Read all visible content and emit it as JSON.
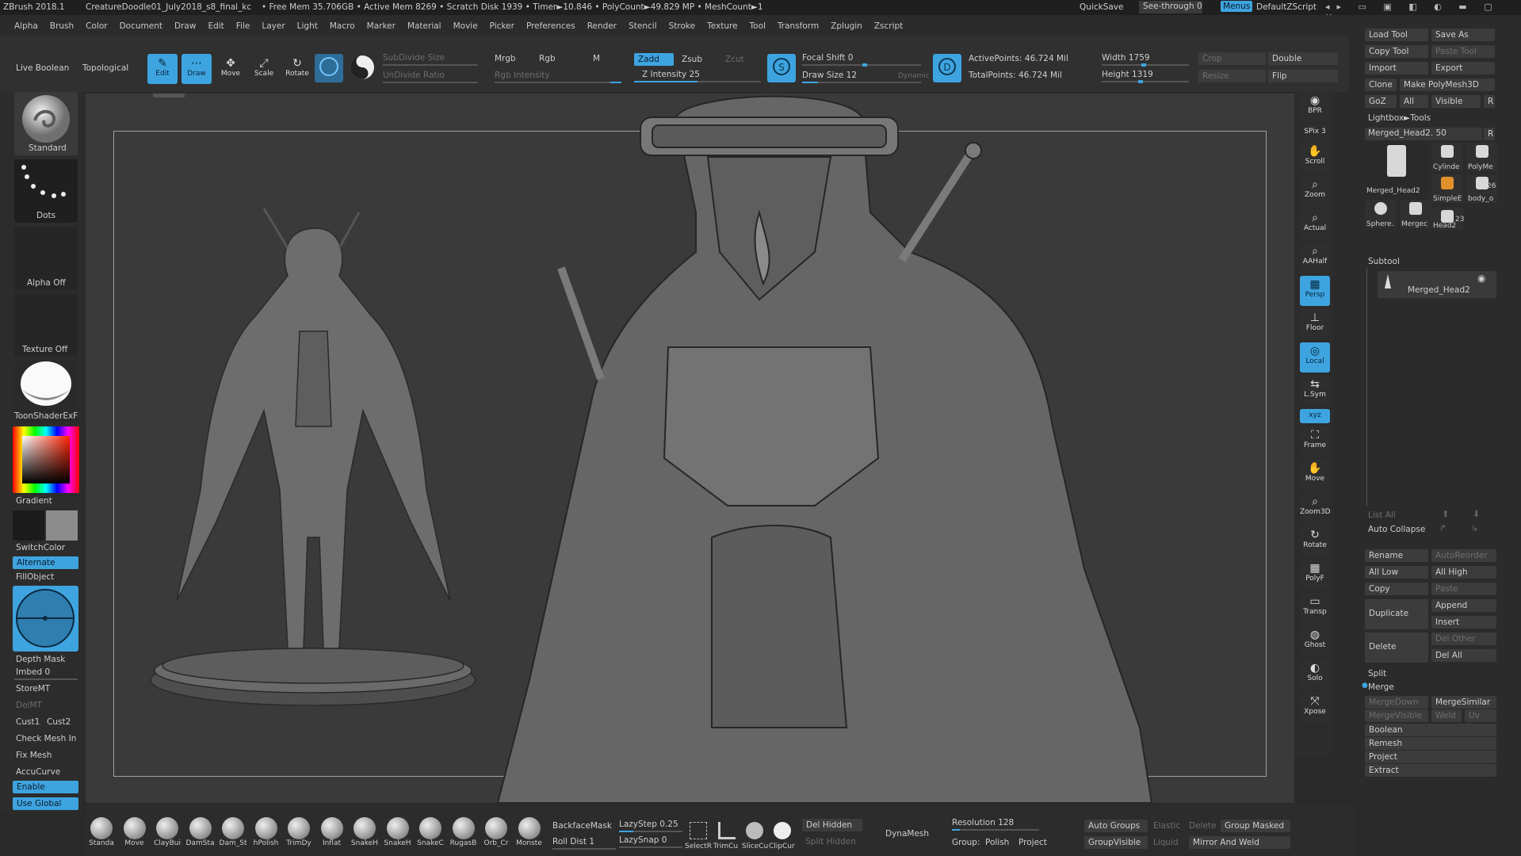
{
  "titlebar": {
    "title": "ZBrush 2018.1",
    "doc": "CreatureDoodle01_July2018_s8_final_kc",
    "stats": "• Free Mem 35.706GB • Active Mem 8269 • Scratch Disk 1939 • Timer►10.846 • PolyCount►49.829 MP • MeshCount►1",
    "quicksave": "QuickSave",
    "seethrough": "See-through  0",
    "menus": "Menus",
    "script": "DefaultZScript"
  },
  "menubar": [
    "Alpha",
    "Brush",
    "Color",
    "Document",
    "Draw",
    "Edit",
    "File",
    "Layer",
    "Light",
    "Macro",
    "Marker",
    "Material",
    "Movie",
    "Picker",
    "Preferences",
    "Render",
    "Stencil",
    "Stroke",
    "Texture",
    "Tool",
    "Transform",
    "Zplugin",
    "Zscript"
  ],
  "toolbar": {
    "live_boolean": "Live Boolean",
    "topological": "Topological",
    "modes": [
      {
        "label": "Edit",
        "on": true
      },
      {
        "label": "Draw",
        "on": true
      },
      {
        "label": "Move",
        "on": false
      },
      {
        "label": "Scale",
        "on": false
      },
      {
        "label": "Rotate",
        "on": false
      }
    ],
    "subdivide_size": "SubDivide Size",
    "undivide_ratio": "UnDivide Ratio",
    "mrgb": "Mrgb",
    "rgb": "Rgb",
    "m": "M",
    "rgb_intensity": "Rgb Intensity",
    "zadd": "Zadd",
    "zsub": "Zsub",
    "zcut": "Zcut",
    "z_intensity": "Z Intensity 25",
    "z_intensity_value": 25,
    "focal_shift": "Focal Shift 0",
    "draw_size": "Draw Size 12",
    "dynamic": "Dynamic",
    "active_points": "ActivePoints: 46.724 Mil",
    "total_points": "TotalPoints: 46.724 Mil",
    "width": "Width 1759",
    "height": "Height 1319",
    "crop": "Crop",
    "resize": "Resize",
    "double": "Double",
    "flip": "Flip"
  },
  "left_shelf": {
    "brush": "Standard",
    "stroke": "Dots",
    "alpha": "Alpha Off",
    "texture": "Texture Off",
    "material": "ToonShaderExF",
    "gradient": "Gradient",
    "switch_color": "SwitchColor",
    "alternate": "Alternate",
    "fill_object": "FillObject",
    "depth_mask": "Depth Mask",
    "imbed": "Imbed 0",
    "store_mt": "StoreMT",
    "del_mt": "DelMT",
    "cust1": "Cust1",
    "cust2": "Cust2",
    "check_mesh": "Check Mesh In",
    "fix_mesh": "Fix Mesh",
    "accucurve": "AccuCurve",
    "enable": "Enable",
    "use_global": "Use Global"
  },
  "right_shelf": [
    {
      "label": "BPR"
    },
    {
      "label": "SPix 3"
    },
    {
      "label": "Scroll"
    },
    {
      "label": "Zoom"
    },
    {
      "label": "Actual"
    },
    {
      "label": "AAHalf"
    },
    {
      "label": "Persp",
      "on": true
    },
    {
      "label": "Floor"
    },
    {
      "label": "Local",
      "on": true
    },
    {
      "label": "L.Sym"
    },
    {
      "label": "xyz",
      "on": true
    },
    {
      "label": "Frame"
    },
    {
      "label": "Move"
    },
    {
      "label": "Zoom3D"
    },
    {
      "label": "Rotate"
    },
    {
      "label": "PolyF"
    },
    {
      "label": "Transp"
    },
    {
      "label": "Ghost"
    },
    {
      "label": "Solo"
    },
    {
      "label": "Xpose"
    }
  ],
  "tool_panel": {
    "load_tool": "Load Tool",
    "save_as": "Save As",
    "copy_tool": "Copy Tool",
    "paste_tool": "Paste Tool",
    "import": "Import",
    "export": "Export",
    "clone": "Clone",
    "make_polymesh": "Make PolyMesh3D",
    "goz": "GoZ",
    "all": "All",
    "visible": "Visible",
    "r": "R",
    "lightbox": "Lightbox►Tools",
    "current_tool": "Merged_Head2. 50",
    "thumbs": [
      {
        "label": "Merged_Head2"
      },
      {
        "label": "Cylinde"
      },
      {
        "label": "PolyMe"
      },
      {
        "label": "SimpleE"
      },
      {
        "label": "body_o"
      },
      {
        "label": "Sphere."
      },
      {
        "label": "Mergec"
      },
      {
        "label": "Head2"
      }
    ],
    "count_26": "26",
    "count_23": "23"
  },
  "subtool": {
    "title": "Subtool",
    "item": "Merged_Head2",
    "list_all": "List All",
    "auto_collapse": "Auto Collapse",
    "rename": "Rename",
    "auto_reorder": "AutoReorder",
    "all_low": "All Low",
    "all_high": "All High",
    "copy": "Copy",
    "paste": "Paste",
    "append": "Append",
    "duplicate": "Duplicate",
    "insert": "Insert",
    "del_other": "Del Other",
    "delete": "Delete",
    "del_all": "Del All",
    "split": "Split",
    "merge": "Merge",
    "merge_down": "MergeDown",
    "merge_similar": "MergeSimilar",
    "merge_visible": "MergeVisible",
    "weld": "Weld",
    "uv": "Uv",
    "boolean": "Boolean",
    "remesh": "Remesh",
    "project": "Project",
    "extract": "Extract"
  },
  "bottom_bar": {
    "brushes": [
      "Standa",
      "Move",
      "ClayBui",
      "DamSta",
      "Dam_St",
      "hPolish",
      "TrimDy",
      "Inflat",
      "SnakeH",
      "SnakeH",
      "SnakeC",
      "RugasB",
      "Orb_Cr",
      "Monste"
    ],
    "backface": "BackfaceMask",
    "roll_dist": "Roll Dist 1",
    "lazystep": "LazyStep 0.25",
    "lazysnap": "LazySnap 0",
    "select": "SelectR",
    "trim": "TrimCu",
    "slice": "SliceCu",
    "clip": "ClipCur",
    "del_hidden": "Del Hidden",
    "split_hidden": "Split Hidden",
    "dynamesh": "DynaMesh",
    "resolution": "Resolution 128",
    "group_label": "Group:",
    "polish": "Polish",
    "project": "Project",
    "auto_groups": "Auto Groups",
    "elastic": "Elastic",
    "delete": "Delete",
    "group_masked": "Group Masked",
    "group_visible": "GroupVisible",
    "liquid": "Liquid",
    "mirror_weld": "Mirror And Weld"
  },
  "colors": {
    "accent": "#3ea4e0",
    "bg": "#2a2a2a",
    "panel": "#333333",
    "canvas": "#3b3b3b"
  }
}
